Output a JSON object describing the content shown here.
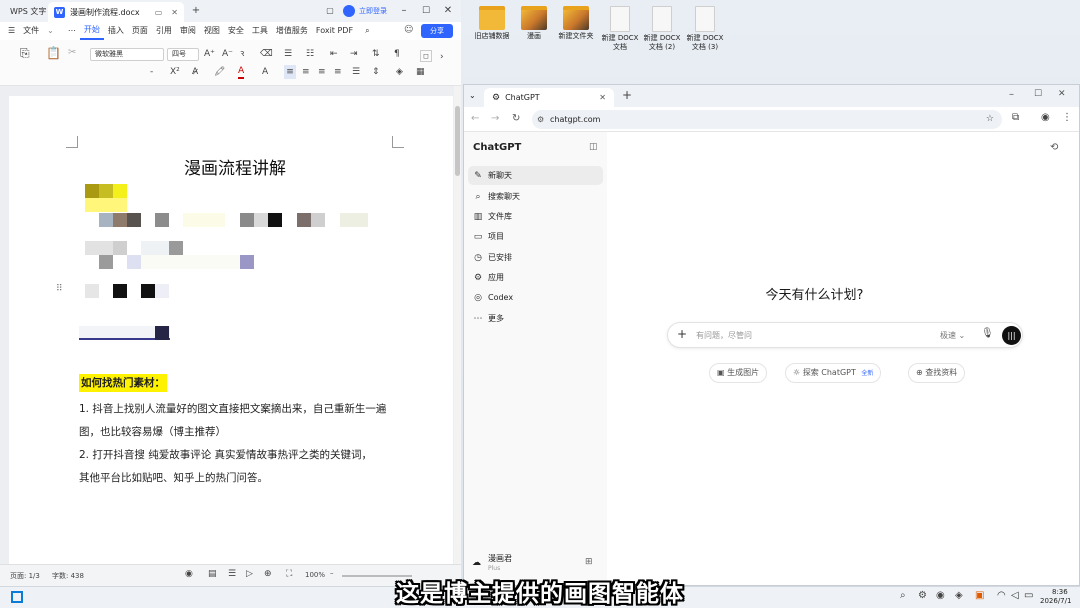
{
  "desktop": {
    "icons": [
      {
        "label": "旧店铺数据",
        "type": "folder"
      },
      {
        "label": "漫画",
        "type": "pic"
      },
      {
        "label": "新建文件夹",
        "type": "pic"
      },
      {
        "label": "新建 DOCX 文档",
        "type": "doc"
      },
      {
        "label": "新建 DOCX 文档 (2)",
        "type": "doc"
      },
      {
        "label": "新建 DOCX 文档 (3)",
        "type": "doc"
      }
    ]
  },
  "wps": {
    "app_tab": "WPS 文字",
    "doc_tab": "漫画制作流程.docx",
    "login": "立即登录",
    "menu": {
      "file": "文件",
      "items": [
        "开始",
        "插入",
        "页面",
        "引用",
        "审阅",
        "视图",
        "安全",
        "工具",
        "增值服务",
        "Foxit PDF"
      ],
      "active": "开始"
    },
    "share": "分享",
    "ribbon": {
      "font_name": "微软雅黑",
      "font_size": "四号"
    },
    "document": {
      "title": "漫画流程讲解",
      "heading": "如何找热门素材：",
      "paragraphs": [
        "1. 抖音上找别人流量好的图文直接把文案摘出来，自己重新生一遍",
        "图，也比较容易爆（博主推荐）",
        "2. 打开抖音搜   纯爱故事评论     真实爱情故事热评之类的关键词，",
        "其他平台比如贴吧、知乎上的热门问答。"
      ]
    },
    "status": {
      "page": "页面: 1/3",
      "words": "字数: 438",
      "zoom": "100%"
    }
  },
  "chrome": {
    "tab_title": "ChatGPT",
    "url": "chatgpt.com"
  },
  "chatgpt": {
    "logo": "ChatGPT",
    "nav": [
      {
        "label": "新聊天",
        "icon": "edit-icon"
      },
      {
        "label": "搜索聊天",
        "icon": "search-icon"
      },
      {
        "label": "文件库",
        "icon": "library-icon"
      },
      {
        "label": "项目",
        "icon": "folder-icon"
      },
      {
        "label": "已安排",
        "icon": "schedule-icon"
      },
      {
        "label": "应用",
        "icon": "apps-icon"
      },
      {
        "label": "Codex",
        "icon": "codex-icon"
      },
      {
        "label": "更多",
        "icon": "more-icon"
      }
    ],
    "user": {
      "name": "漫画君",
      "plan": "Plus"
    },
    "headline": "今天有什么计划?",
    "input": {
      "placeholder": "有问题，尽管问",
      "model": "极速"
    },
    "chips": [
      {
        "label": "生成图片"
      },
      {
        "label": "探索 ChatGPT",
        "badge": "全新"
      },
      {
        "label": "查找资料"
      }
    ]
  },
  "taskbar": {
    "time": "8:36",
    "date": "2026/7/1"
  },
  "subtitle": "这是博主提供的画图智能体"
}
